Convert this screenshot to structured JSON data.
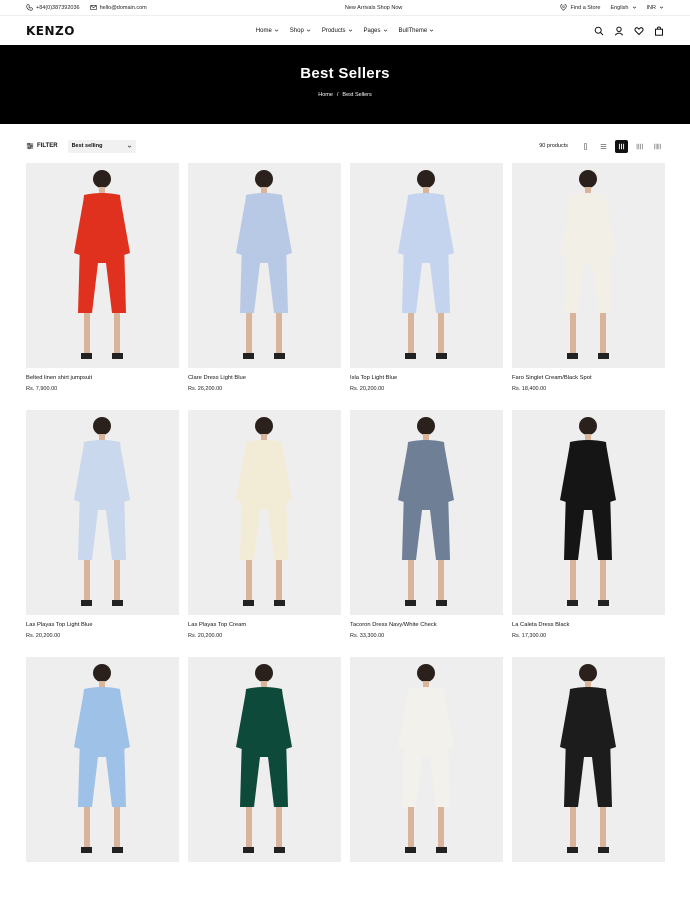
{
  "topbar": {
    "phone": "+84(0)387392036",
    "email": "hello@domain.com",
    "promo": "New Arrivals Shop Now",
    "find_store": "Find a Store",
    "language": "English",
    "currency": "INR"
  },
  "header": {
    "logo": "KENZO",
    "nav": [
      "Home",
      "Shop",
      "Products",
      "Pages",
      "BullTheme"
    ]
  },
  "hero": {
    "title": "Best Sellers",
    "breadcrumb": [
      "Home",
      "/",
      "Best Sellers"
    ]
  },
  "toolbar": {
    "filter_label": "FILTER",
    "sort_value": "Best selling",
    "count": "90 products",
    "active_view": 2
  },
  "products": [
    {
      "name": "Belted linen shirt jumpsuit",
      "price": "Rs. 7,900.00",
      "color": "#e0301e"
    },
    {
      "name": "Clare Dress Light Blue",
      "price": "Rs. 26,200.00",
      "color": "#b8c9e6"
    },
    {
      "name": "Isla Top Light Blue",
      "price": "Rs. 20,200.00",
      "color": "#c4d3ee"
    },
    {
      "name": "Faro Singlet Cream/Black Spot",
      "price": "Rs. 18,400.00",
      "color": "#f2efe6"
    },
    {
      "name": "Las Playas Top Light Blue",
      "price": "Rs. 20,200.00",
      "color": "#c9d8ec"
    },
    {
      "name": "Las Playas Top Cream",
      "price": "Rs. 20,200.00",
      "color": "#f2ecd6"
    },
    {
      "name": "Tacoron Dress Navy/White Check",
      "price": "Rs. 33,300.00",
      "color": "#6f7f96"
    },
    {
      "name": "La Caleta Dress Black",
      "price": "Rs. 17,300.00",
      "color": "#151515"
    },
    {
      "name": "",
      "price": "",
      "color": "#9ec1e8"
    },
    {
      "name": "",
      "price": "",
      "color": "#0e4a3a"
    },
    {
      "name": "",
      "price": "",
      "color": "#f3f1ec"
    },
    {
      "name": "",
      "price": "",
      "color": "#1c1c1c"
    }
  ]
}
